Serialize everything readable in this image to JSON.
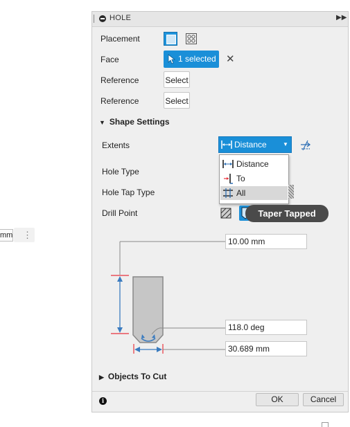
{
  "background_fragment": {
    "field_value": "mm"
  },
  "dialog": {
    "title": "HOLE",
    "placement": {
      "label": "Placement"
    },
    "face": {
      "label": "Face",
      "value": "1 selected"
    },
    "reference_1": {
      "label": "Reference",
      "button": "Select"
    },
    "reference_2": {
      "label": "Reference",
      "button": "Select"
    },
    "shape_settings": {
      "header": "Shape Settings",
      "extents": {
        "label": "Extents",
        "value": "Distance"
      },
      "extents_menu": [
        "Distance",
        "To",
        "All"
      ],
      "hole_type": {
        "label": "Hole Type"
      },
      "hole_tap_type": {
        "label": "Hole Tap Type"
      },
      "drill_point": {
        "label": "Drill Point"
      },
      "tooltip": "Taper Tapped"
    },
    "dimensions": {
      "depth": "10.00 mm",
      "angle": "118.0 deg",
      "diameter": "30.689 mm"
    },
    "objects_to_cut": {
      "header": "Objects To Cut"
    },
    "footer": {
      "ok": "OK",
      "cancel": "Cancel"
    }
  },
  "colors": {
    "accent": "#1a8fd8",
    "dimension": "#3a7bbf",
    "limit_line": "#e8323c"
  }
}
